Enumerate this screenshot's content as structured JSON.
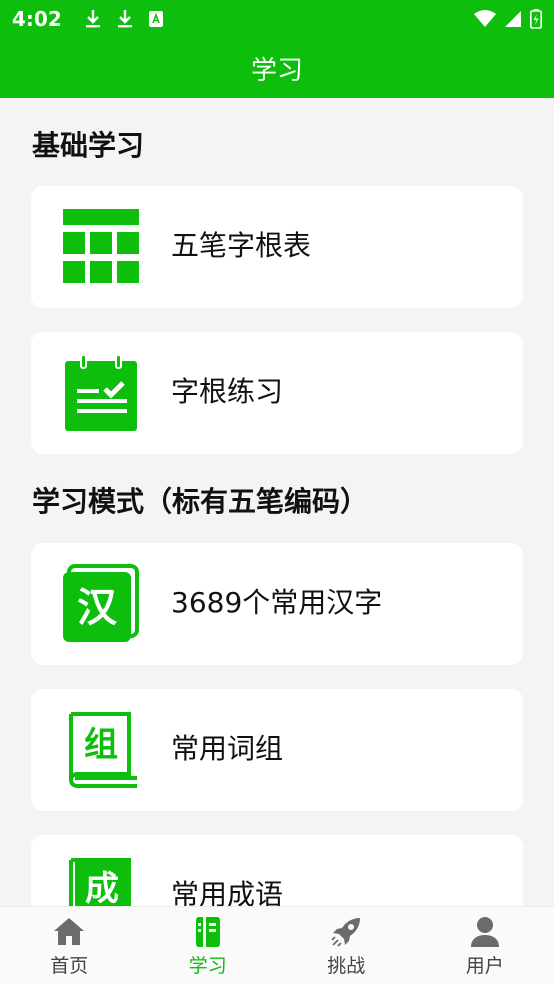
{
  "status_bar": {
    "time": "4:02",
    "left_icons": [
      "download-icon",
      "download-icon",
      "translate-icon"
    ],
    "right_icons": [
      "wifi-icon",
      "signal-icon",
      "battery-icon"
    ]
  },
  "app_bar": {
    "title": "学习"
  },
  "sections": [
    {
      "title": "基础学习",
      "cards": [
        {
          "label": "五笔字根表",
          "icon": "table-grid-icon"
        },
        {
          "label": "字根练习",
          "icon": "practice-notepad-icon"
        }
      ]
    },
    {
      "title": "学习模式（标有五笔编码）",
      "cards": [
        {
          "label": "3689个常用汉字",
          "icon": "hanzi-card-icon",
          "glyph": "汉"
        },
        {
          "label": "常用词组",
          "icon": "phrase-book-icon",
          "glyph": "组"
        },
        {
          "label": "常用成语",
          "icon": "idiom-book-icon",
          "glyph": "成"
        }
      ]
    }
  ],
  "bottom_nav": [
    {
      "label": "首页",
      "icon": "home-icon",
      "active": false
    },
    {
      "label": "学习",
      "icon": "book-icon",
      "active": true
    },
    {
      "label": "挑战",
      "icon": "rocket-icon",
      "active": false
    },
    {
      "label": "用户",
      "icon": "user-icon",
      "active": false
    }
  ],
  "colors": {
    "accent": "#0dbe0d",
    "background": "#f4f4f4",
    "card": "#ffffff",
    "nav_inactive": "#666666"
  }
}
